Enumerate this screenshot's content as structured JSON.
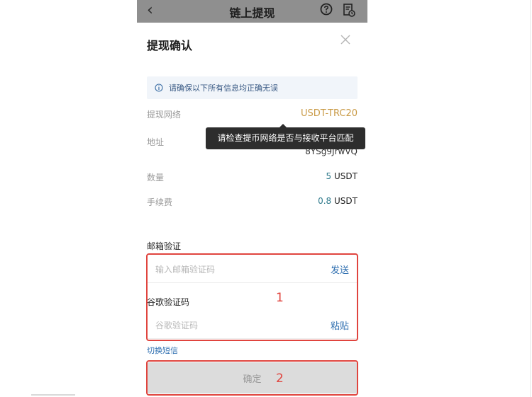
{
  "header": {
    "back": "‹",
    "title": "链上提现",
    "help_icon": "question-circle-icon",
    "records_icon": "records-icon"
  },
  "sheet": {
    "title": "提现确认",
    "close_icon": "close-icon",
    "notice": "请确保以下所有信息均正确无误",
    "rows": {
      "network": {
        "label": "提现网络",
        "value": "USDT-TRC20"
      },
      "address": {
        "label": "地址",
        "value": "8YSg9JrwVQ"
      },
      "amount": {
        "label": "数量",
        "num": "5",
        "unit": "USDT"
      },
      "fee": {
        "label": "手续费",
        "num": "0.8",
        "unit": "USDT"
      }
    },
    "tooltip": "请检查提币网络是否与接收平台匹配",
    "email": {
      "label": "邮箱验证",
      "placeholder": "输入邮箱验证码",
      "action": "发送"
    },
    "google": {
      "label": "谷歌验证码",
      "placeholder": "谷歌验证码",
      "action": "粘贴"
    },
    "switch_link": "切换短信",
    "confirm": "确定"
  },
  "annotations": {
    "mark1": "1",
    "mark2": "2"
  },
  "colors": {
    "accent": "#2f6fb0",
    "network": "#c99a46",
    "highlight": "#e0443e"
  }
}
